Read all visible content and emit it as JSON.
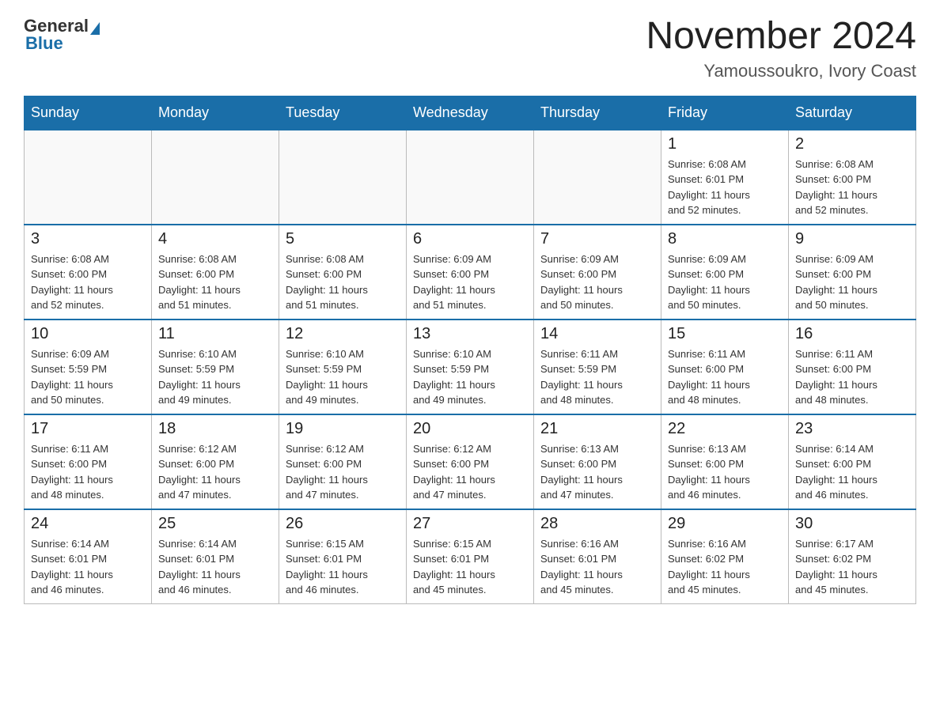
{
  "header": {
    "logo_general": "General",
    "logo_blue": "Blue",
    "title": "November 2024",
    "subtitle": "Yamoussoukro, Ivory Coast"
  },
  "weekdays": [
    "Sunday",
    "Monday",
    "Tuesday",
    "Wednesday",
    "Thursday",
    "Friday",
    "Saturday"
  ],
  "weeks": [
    [
      {
        "day": "",
        "info": ""
      },
      {
        "day": "",
        "info": ""
      },
      {
        "day": "",
        "info": ""
      },
      {
        "day": "",
        "info": ""
      },
      {
        "day": "",
        "info": ""
      },
      {
        "day": "1",
        "info": "Sunrise: 6:08 AM\nSunset: 6:01 PM\nDaylight: 11 hours\nand 52 minutes."
      },
      {
        "day": "2",
        "info": "Sunrise: 6:08 AM\nSunset: 6:00 PM\nDaylight: 11 hours\nand 52 minutes."
      }
    ],
    [
      {
        "day": "3",
        "info": "Sunrise: 6:08 AM\nSunset: 6:00 PM\nDaylight: 11 hours\nand 52 minutes."
      },
      {
        "day": "4",
        "info": "Sunrise: 6:08 AM\nSunset: 6:00 PM\nDaylight: 11 hours\nand 51 minutes."
      },
      {
        "day": "5",
        "info": "Sunrise: 6:08 AM\nSunset: 6:00 PM\nDaylight: 11 hours\nand 51 minutes."
      },
      {
        "day": "6",
        "info": "Sunrise: 6:09 AM\nSunset: 6:00 PM\nDaylight: 11 hours\nand 51 minutes."
      },
      {
        "day": "7",
        "info": "Sunrise: 6:09 AM\nSunset: 6:00 PM\nDaylight: 11 hours\nand 50 minutes."
      },
      {
        "day": "8",
        "info": "Sunrise: 6:09 AM\nSunset: 6:00 PM\nDaylight: 11 hours\nand 50 minutes."
      },
      {
        "day": "9",
        "info": "Sunrise: 6:09 AM\nSunset: 6:00 PM\nDaylight: 11 hours\nand 50 minutes."
      }
    ],
    [
      {
        "day": "10",
        "info": "Sunrise: 6:09 AM\nSunset: 5:59 PM\nDaylight: 11 hours\nand 50 minutes."
      },
      {
        "day": "11",
        "info": "Sunrise: 6:10 AM\nSunset: 5:59 PM\nDaylight: 11 hours\nand 49 minutes."
      },
      {
        "day": "12",
        "info": "Sunrise: 6:10 AM\nSunset: 5:59 PM\nDaylight: 11 hours\nand 49 minutes."
      },
      {
        "day": "13",
        "info": "Sunrise: 6:10 AM\nSunset: 5:59 PM\nDaylight: 11 hours\nand 49 minutes."
      },
      {
        "day": "14",
        "info": "Sunrise: 6:11 AM\nSunset: 5:59 PM\nDaylight: 11 hours\nand 48 minutes."
      },
      {
        "day": "15",
        "info": "Sunrise: 6:11 AM\nSunset: 6:00 PM\nDaylight: 11 hours\nand 48 minutes."
      },
      {
        "day": "16",
        "info": "Sunrise: 6:11 AM\nSunset: 6:00 PM\nDaylight: 11 hours\nand 48 minutes."
      }
    ],
    [
      {
        "day": "17",
        "info": "Sunrise: 6:11 AM\nSunset: 6:00 PM\nDaylight: 11 hours\nand 48 minutes."
      },
      {
        "day": "18",
        "info": "Sunrise: 6:12 AM\nSunset: 6:00 PM\nDaylight: 11 hours\nand 47 minutes."
      },
      {
        "day": "19",
        "info": "Sunrise: 6:12 AM\nSunset: 6:00 PM\nDaylight: 11 hours\nand 47 minutes."
      },
      {
        "day": "20",
        "info": "Sunrise: 6:12 AM\nSunset: 6:00 PM\nDaylight: 11 hours\nand 47 minutes."
      },
      {
        "day": "21",
        "info": "Sunrise: 6:13 AM\nSunset: 6:00 PM\nDaylight: 11 hours\nand 47 minutes."
      },
      {
        "day": "22",
        "info": "Sunrise: 6:13 AM\nSunset: 6:00 PM\nDaylight: 11 hours\nand 46 minutes."
      },
      {
        "day": "23",
        "info": "Sunrise: 6:14 AM\nSunset: 6:00 PM\nDaylight: 11 hours\nand 46 minutes."
      }
    ],
    [
      {
        "day": "24",
        "info": "Sunrise: 6:14 AM\nSunset: 6:01 PM\nDaylight: 11 hours\nand 46 minutes."
      },
      {
        "day": "25",
        "info": "Sunrise: 6:14 AM\nSunset: 6:01 PM\nDaylight: 11 hours\nand 46 minutes."
      },
      {
        "day": "26",
        "info": "Sunrise: 6:15 AM\nSunset: 6:01 PM\nDaylight: 11 hours\nand 46 minutes."
      },
      {
        "day": "27",
        "info": "Sunrise: 6:15 AM\nSunset: 6:01 PM\nDaylight: 11 hours\nand 45 minutes."
      },
      {
        "day": "28",
        "info": "Sunrise: 6:16 AM\nSunset: 6:01 PM\nDaylight: 11 hours\nand 45 minutes."
      },
      {
        "day": "29",
        "info": "Sunrise: 6:16 AM\nSunset: 6:02 PM\nDaylight: 11 hours\nand 45 minutes."
      },
      {
        "day": "30",
        "info": "Sunrise: 6:17 AM\nSunset: 6:02 PM\nDaylight: 11 hours\nand 45 minutes."
      }
    ]
  ]
}
